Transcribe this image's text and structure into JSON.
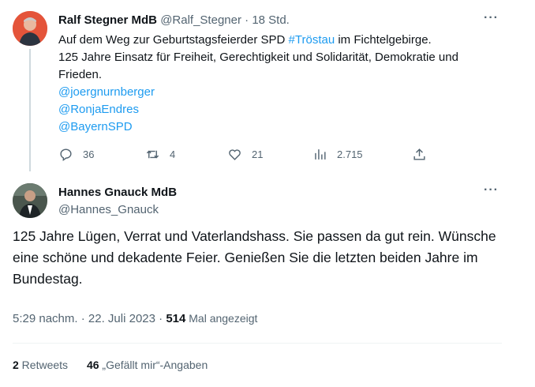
{
  "tweet1": {
    "author_name": "Ralf Stegner MdB",
    "handle": "@Ralf_Stegner",
    "separator": "·",
    "time": "18 Std.",
    "more_label": "···",
    "text_line1_a": "Auf dem Weg zur Geburtstagsfeierder SPD ",
    "hashtag": "#Tröstau",
    "text_line1_b": " im Fichtelgebirge.",
    "text_line2": "125 Jahre Einsatz für Freiheit, Gerechtigkeit und Solidarität, Demokratie und Frieden.",
    "mentions": [
      "@joergnurnberger",
      "@RonjaEndres",
      "@BayernSPD"
    ],
    "actions": {
      "replies": "36",
      "retweets": "4",
      "likes": "21",
      "views": "2.715"
    }
  },
  "tweet2": {
    "author_name": "Hannes Gnauck MdB",
    "handle": "@Hannes_Gnauck",
    "more_label": "···",
    "text": "125 Jahre Lügen, Verrat und Vaterlandshass. Sie passen da gut rein. Wünsche eine schöne und dekadente Feier. Genießen Sie die letzten beiden Jahre im Bundestag.",
    "time": "5:29 nachm.",
    "dot": " · ",
    "date": "22. Juli 2023",
    "dot2": " · ",
    "views_count": "514",
    "views_label": " Mal angezeigt",
    "retweets_count": "2",
    "retweets_label": " Retweets",
    "likes_count": "46",
    "likes_label": " „Gefällt mir“-Angaben"
  },
  "colors": {
    "link": "#1d9bf0",
    "text": "#0f1419",
    "muted": "#536471",
    "divider": "#eff3f4"
  }
}
